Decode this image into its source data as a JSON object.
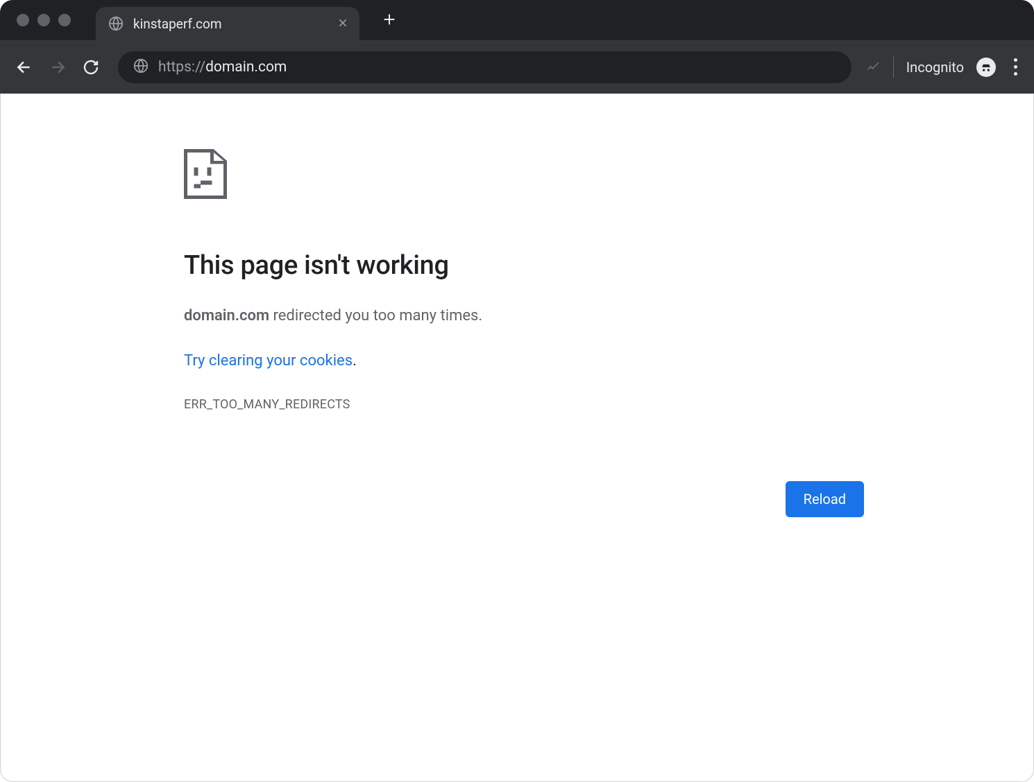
{
  "tab": {
    "title": "kinstaperf.com"
  },
  "address": {
    "scheme": "https://",
    "host": "domain.com"
  },
  "incognito": {
    "label": "Incognito"
  },
  "error": {
    "heading": "This page isn't working",
    "domain": "domain.com",
    "message_suffix": " redirected you too many times.",
    "link_text": "Try clearing your cookies",
    "link_period": ".",
    "code": "ERR_TOO_MANY_REDIRECTS",
    "reload_label": "Reload"
  }
}
